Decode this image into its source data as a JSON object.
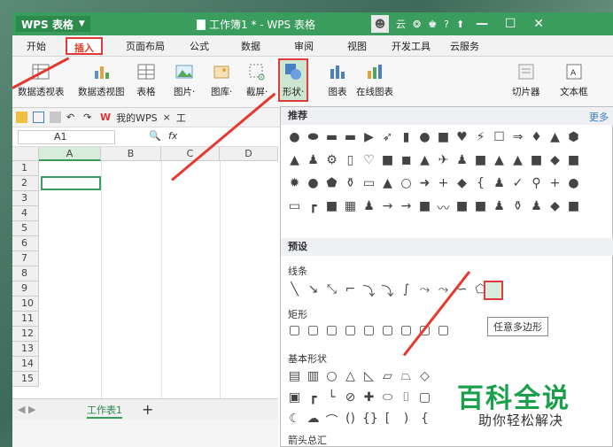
{
  "title_bar": {
    "app_name": "WPS 表格",
    "doc_title": "工作簿1 * - WPS 表格",
    "user_label": "云",
    "min_label": "—",
    "max_label": "☐",
    "close_label": "✕"
  },
  "menu": {
    "tabs": [
      "开始",
      "插入",
      "页面布局",
      "公式",
      "数据",
      "审阅",
      "视图",
      "开发工具",
      "云服务"
    ],
    "active": "插入"
  },
  "ribbon": {
    "items": [
      "数据透视表",
      "数据透视图",
      "表格",
      "图片·",
      "图库·",
      "截屏·",
      "形状·",
      "图表",
      "在线图表",
      "切片器",
      "文本框"
    ]
  },
  "quick_access": {
    "wps_label": "我的WPS",
    "close": "×",
    "tab_label": "工"
  },
  "formula_bar": {
    "cell_ref": "A1",
    "fx": "fx"
  },
  "grid": {
    "columns": [
      "A",
      "B",
      "C",
      "D"
    ],
    "rows": [
      "1",
      "2",
      "3",
      "4",
      "5",
      "6",
      "7",
      "8",
      "9",
      "10",
      "11",
      "12",
      "13",
      "14",
      "15"
    ]
  },
  "sheet": {
    "tab": "工作表1",
    "add": "+"
  },
  "shapes_panel": {
    "recommended": "推荐",
    "more": "更多",
    "preset": "预设",
    "sections": [
      "线条",
      "矩形",
      "基本形状",
      "箭头总汇"
    ],
    "tooltip": "任意多边形"
  },
  "watermark": {
    "title": "百科全说",
    "subtitle": "助你轻松解决"
  },
  "colors": {
    "titlebar": "#3a9c5d",
    "highlight": "#e03a3a",
    "watermark_green": "#1aa04a"
  }
}
